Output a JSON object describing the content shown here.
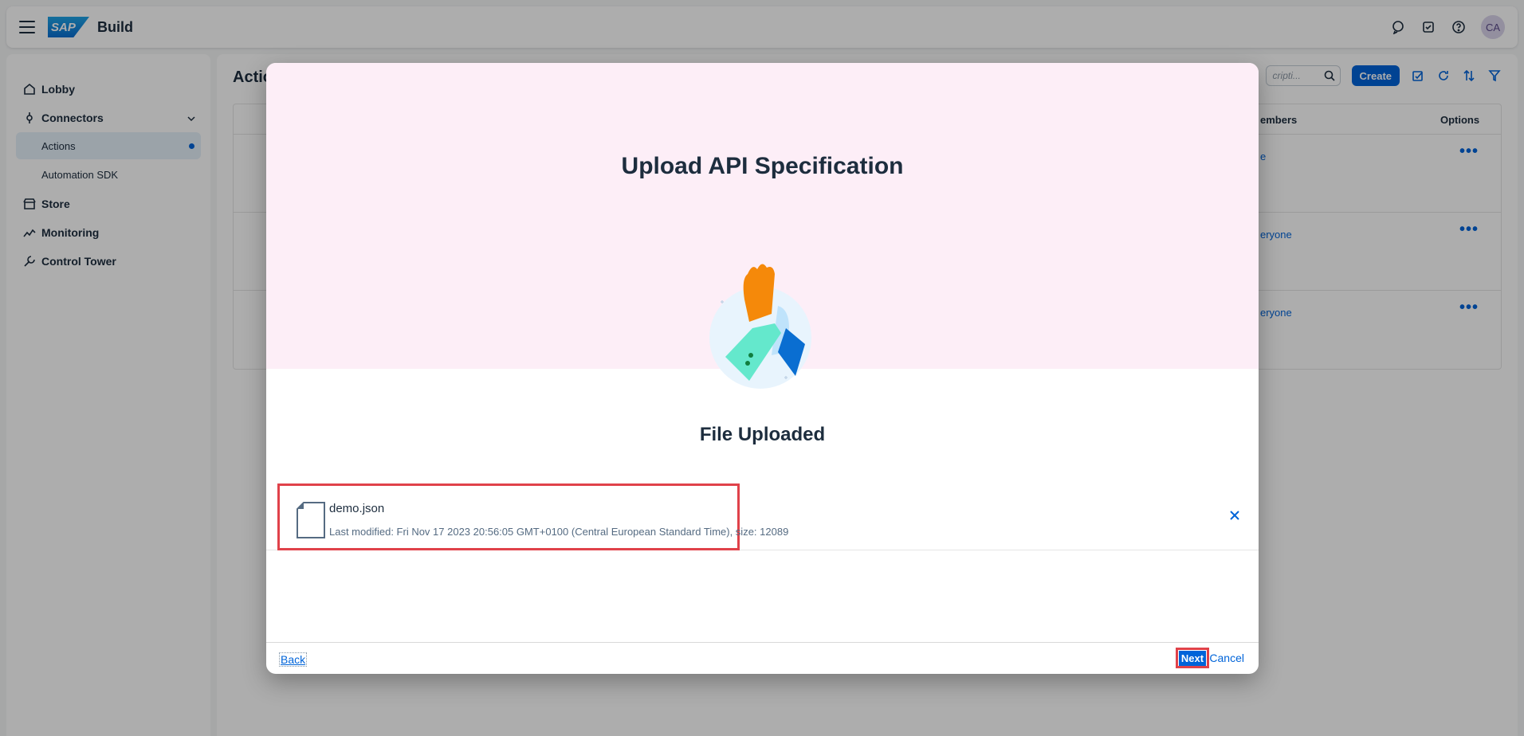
{
  "shell": {
    "brand": "Build",
    "logo_text": "SAP",
    "avatar_initials": "CA",
    "icons": [
      "feedback-icon",
      "inbox-icon",
      "help-icon"
    ]
  },
  "sidenav": {
    "items": [
      {
        "label": "Lobby",
        "icon": "home-icon"
      },
      {
        "label": "Connectors",
        "icon": "connector-icon"
      },
      {
        "label": "Store",
        "icon": "store-icon"
      },
      {
        "label": "Monitoring",
        "icon": "monitoring-icon"
      },
      {
        "label": "Control Tower",
        "icon": "wrench-icon"
      }
    ],
    "subitems": [
      {
        "label": "Actions",
        "active": true
      },
      {
        "label": "Automation SDK",
        "active": false
      }
    ]
  },
  "main": {
    "title": "Actio",
    "search_placeholder": "cripti...",
    "create_label": "Create",
    "columns": {
      "members": "embers",
      "options": "Options"
    },
    "rows": [
      {
        "members": "e",
        "options": "•••"
      },
      {
        "members": "eryone",
        "options": "•••"
      },
      {
        "members": "eryone",
        "options": "•••"
      }
    ]
  },
  "dialog": {
    "title": "Upload API Specification",
    "uploaded_title": "File Uploaded",
    "file": {
      "name": "demo.json",
      "meta": "Last modified: Fri Nov 17 2023 20:56:05 GMT+0100 (Central European Standard Time), size: 12089"
    },
    "back_label": "Back",
    "next_label": "Next",
    "cancel_label": "Cancel"
  },
  "colors": {
    "accent": "#0064d9",
    "highlight": "#e0424a",
    "hero": "#fdeef7"
  }
}
